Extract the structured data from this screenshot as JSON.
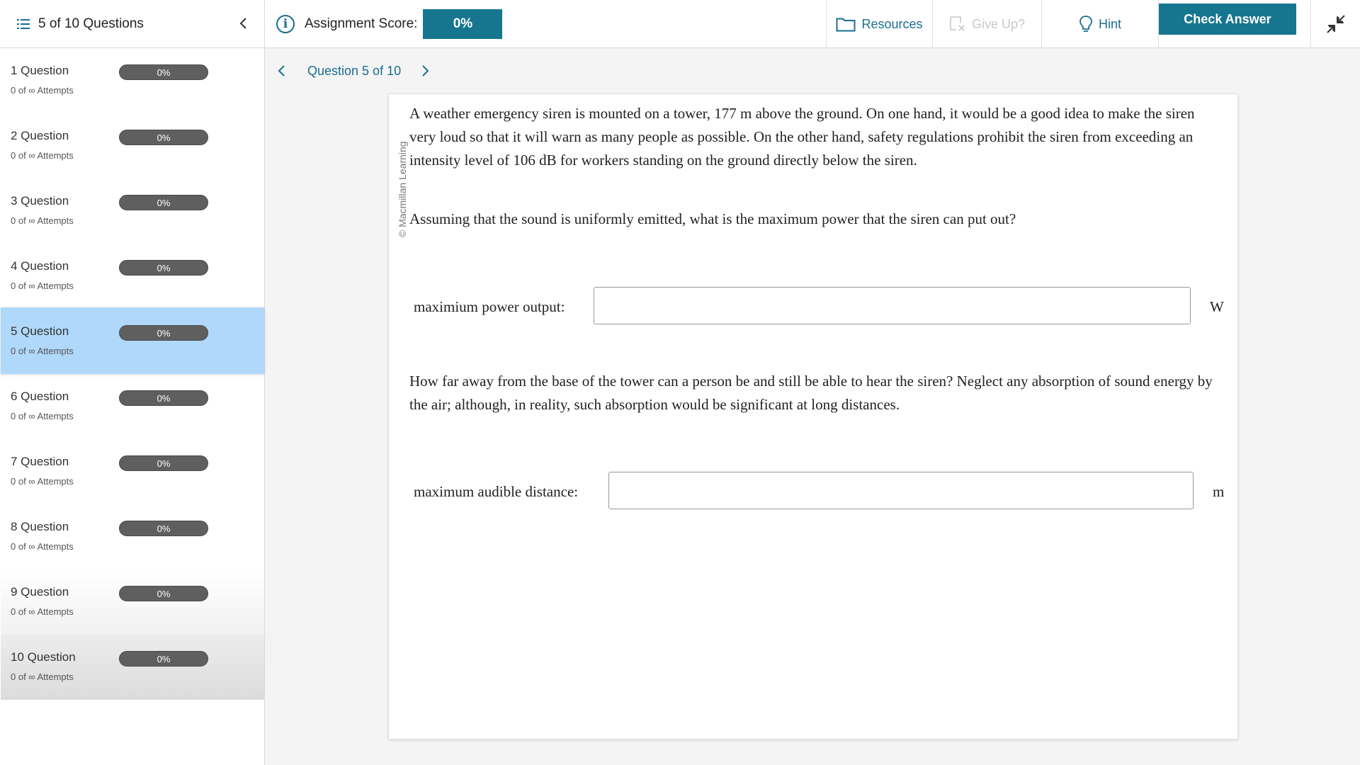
{
  "header": {
    "question_count": "5 of 10 Questions",
    "score_label": "Assignment Score:",
    "score_value": "0%",
    "resources_label": "Resources",
    "giveup_label": "Give Up?",
    "hint_label": "Hint",
    "check_label": "Check Answer"
  },
  "sidebar": {
    "items": [
      {
        "name": "1 Question",
        "attempts": "0 of ∞ Attempts",
        "score": "0%"
      },
      {
        "name": "2 Question",
        "attempts": "0 of ∞ Attempts",
        "score": "0%"
      },
      {
        "name": "3 Question",
        "attempts": "0 of ∞ Attempts",
        "score": "0%"
      },
      {
        "name": "4 Question",
        "attempts": "0 of ∞ Attempts",
        "score": "0%"
      },
      {
        "name": "5 Question",
        "attempts": "0 of ∞ Attempts",
        "score": "0%"
      },
      {
        "name": "6 Question",
        "attempts": "0 of ∞ Attempts",
        "score": "0%"
      },
      {
        "name": "7 Question",
        "attempts": "0 of ∞ Attempts",
        "score": "0%"
      },
      {
        "name": "8 Question",
        "attempts": "0 of ∞ Attempts",
        "score": "0%"
      },
      {
        "name": "9 Question",
        "attempts": "0 of ∞ Attempts",
        "score": "0%"
      },
      {
        "name": "10 Question",
        "attempts": "0 of ∞ Attempts",
        "score": "0%"
      }
    ]
  },
  "question_nav": {
    "title": "Question 5 of 10"
  },
  "question": {
    "copyright": "© Macmillan Learning",
    "intro": "A weather emergency siren is mounted on a tower, 177 m above the ground. On one hand, it would be a good idea to make the siren very loud so that it will warn as many people as possible. On the other hand, safety regulations prohibit the siren from exceeding an intensity level of 106 dB for workers standing on the ground directly below the siren.",
    "part1": "Assuming that the sound is uniformly emitted, what is the maximum power that the siren can put out?",
    "answer1_label": "maximium power output:",
    "answer1_value": "",
    "answer1_unit": "W",
    "part2": "How far away from the base of the tower can a person be and still be able to hear the siren? Neglect any absorption of sound energy by the air; although, in reality, such absorption would be significant at long distances.",
    "answer2_label": "maximum audible distance:",
    "answer2_value": "",
    "answer2_unit": "m"
  },
  "colors": {
    "accent": "#17768f",
    "active_item": "#b0d8fb",
    "pill": "#5f5f5f"
  }
}
